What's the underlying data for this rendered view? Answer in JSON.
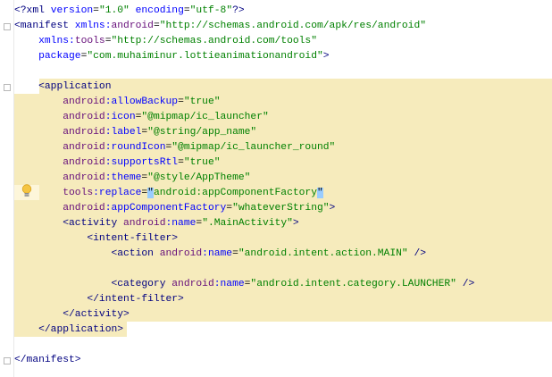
{
  "editor": {
    "lines": [
      [
        [
          "tag",
          "<?xml "
        ],
        [
          "attr",
          "version"
        ],
        [
          "txt",
          "="
        ],
        [
          "val",
          "\"1.0\""
        ],
        [
          "txt",
          " "
        ],
        [
          "attr",
          "encoding"
        ],
        [
          "txt",
          "="
        ],
        [
          "val",
          "\"utf-8\""
        ],
        [
          "tag",
          "?>"
        ]
      ],
      [
        [
          "tag",
          "<manifest "
        ],
        [
          "attr",
          "xmlns:"
        ],
        [
          "ns",
          "android"
        ],
        [
          "txt",
          "="
        ],
        [
          "val",
          "\"http://schemas.android.com/apk/res/android\""
        ]
      ],
      [
        [
          "txt",
          "    "
        ],
        [
          "attr",
          "xmlns:"
        ],
        [
          "ns",
          "tools"
        ],
        [
          "txt",
          "="
        ],
        [
          "val",
          "\"http://schemas.android.com/tools\""
        ]
      ],
      [
        [
          "txt",
          "    "
        ],
        [
          "attr",
          "package"
        ],
        [
          "txt",
          "="
        ],
        [
          "val",
          "\"com.muhaiminur.lottieanimationandroid\""
        ],
        [
          "tag",
          ">"
        ]
      ],
      [],
      [
        [
          "txt",
          "    "
        ],
        [
          "tag",
          "<application"
        ]
      ],
      [
        [
          "txt",
          "        "
        ],
        [
          "ns",
          "android"
        ],
        [
          "attr",
          ":allowBackup"
        ],
        [
          "txt",
          "="
        ],
        [
          "val",
          "\"true\""
        ]
      ],
      [
        [
          "txt",
          "        "
        ],
        [
          "ns",
          "android"
        ],
        [
          "attr",
          ":icon"
        ],
        [
          "txt",
          "="
        ],
        [
          "val",
          "\"@mipmap/ic_launcher\""
        ]
      ],
      [
        [
          "txt",
          "        "
        ],
        [
          "ns",
          "android"
        ],
        [
          "attr",
          ":label"
        ],
        [
          "txt",
          "="
        ],
        [
          "val",
          "\"@string/app_name\""
        ]
      ],
      [
        [
          "txt",
          "        "
        ],
        [
          "ns",
          "android"
        ],
        [
          "attr",
          ":roundIcon"
        ],
        [
          "txt",
          "="
        ],
        [
          "val",
          "\"@mipmap/ic_launcher_round\""
        ]
      ],
      [
        [
          "txt",
          "        "
        ],
        [
          "ns",
          "android"
        ],
        [
          "attr",
          ":supportsRtl"
        ],
        [
          "txt",
          "="
        ],
        [
          "val",
          "\"true\""
        ]
      ],
      [
        [
          "txt",
          "        "
        ],
        [
          "ns",
          "android"
        ],
        [
          "attr",
          ":theme"
        ],
        [
          "txt",
          "="
        ],
        [
          "val",
          "\"@style/AppTheme\""
        ]
      ],
      [
        [
          "txt",
          "        "
        ],
        [
          "ns",
          "tools"
        ],
        [
          "attr",
          ":replace"
        ],
        [
          "txt",
          "="
        ],
        [
          "brace",
          "\""
        ],
        [
          "val",
          "android:appComponentFactory"
        ],
        [
          "brace",
          "\""
        ]
      ],
      [
        [
          "txt",
          "        "
        ],
        [
          "ns",
          "android"
        ],
        [
          "attr",
          ":appComponentFactory"
        ],
        [
          "txt",
          "="
        ],
        [
          "val",
          "\"whateverString\""
        ],
        [
          "tag",
          ">"
        ]
      ],
      [
        [
          "txt",
          "        "
        ],
        [
          "tag",
          "<activity "
        ],
        [
          "ns",
          "android"
        ],
        [
          "attr",
          ":name"
        ],
        [
          "txt",
          "="
        ],
        [
          "val",
          "\".MainActivity\""
        ],
        [
          "tag",
          ">"
        ]
      ],
      [
        [
          "txt",
          "            "
        ],
        [
          "tag",
          "<intent-filter>"
        ]
      ],
      [
        [
          "txt",
          "                "
        ],
        [
          "tag",
          "<action "
        ],
        [
          "ns",
          "android"
        ],
        [
          "attr",
          ":name"
        ],
        [
          "txt",
          "="
        ],
        [
          "val",
          "\"android.intent.action.MAIN\""
        ],
        [
          "tag",
          " />"
        ]
      ],
      [],
      [
        [
          "txt",
          "                "
        ],
        [
          "tag",
          "<category "
        ],
        [
          "ns",
          "android"
        ],
        [
          "attr",
          ":name"
        ],
        [
          "txt",
          "="
        ],
        [
          "val",
          "\"android.intent.category.LAUNCHER\""
        ],
        [
          "tag",
          " />"
        ]
      ],
      [
        [
          "txt",
          "            "
        ],
        [
          "tag",
          "</intent-filter>"
        ]
      ],
      [
        [
          "txt",
          "        "
        ],
        [
          "tag",
          "</activity>"
        ]
      ],
      [
        [
          "txt",
          "    "
        ],
        [
          "tag",
          "</application>"
        ]
      ],
      [],
      [
        [
          "tag",
          "</manifest>"
        ]
      ]
    ]
  }
}
